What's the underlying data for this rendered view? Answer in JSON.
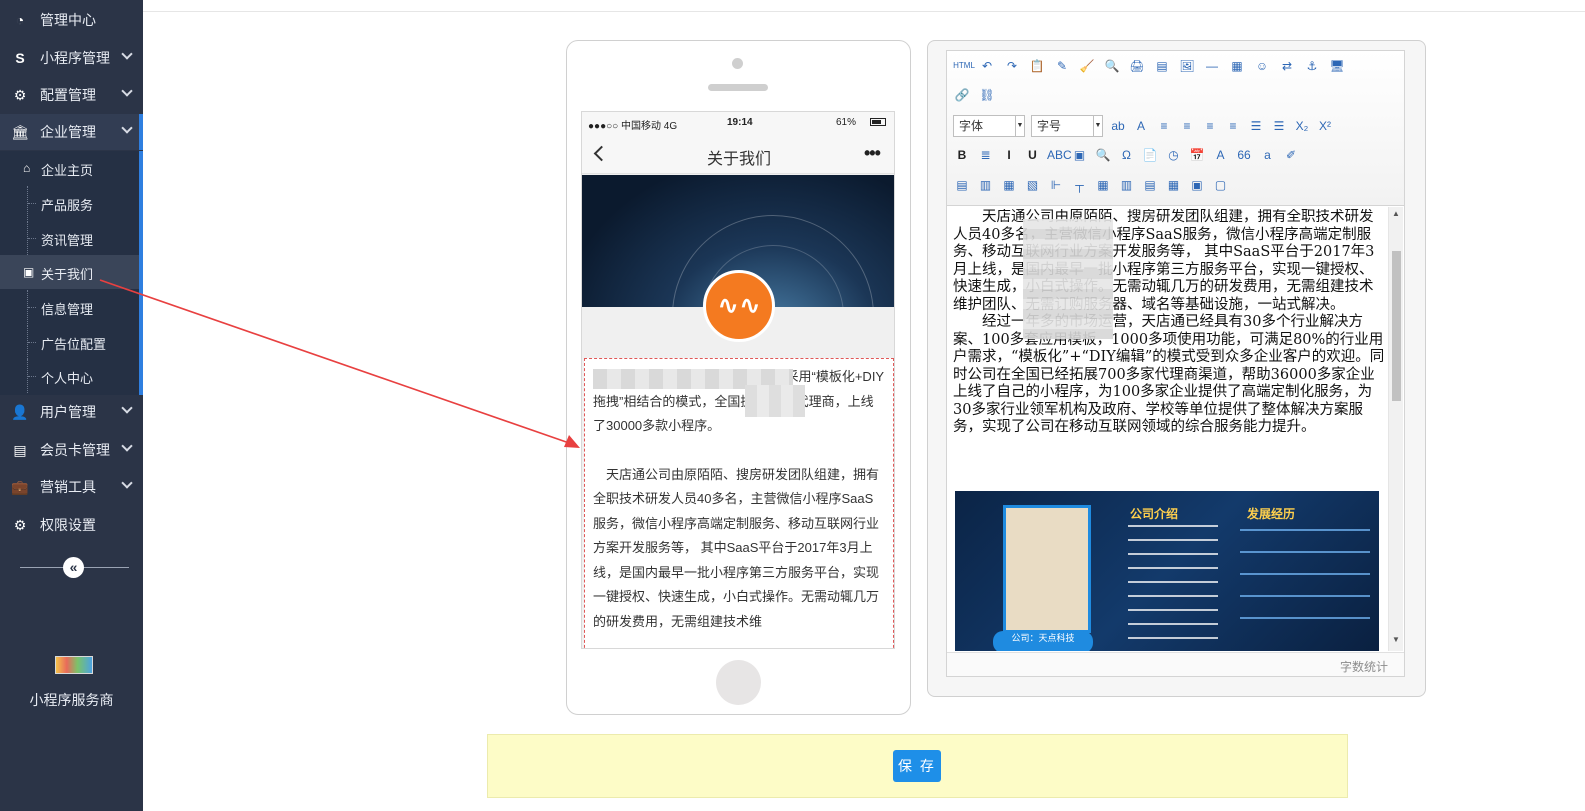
{
  "sidebar": {
    "items": [
      {
        "label": "管理中心",
        "icon": "dashboard-icon"
      },
      {
        "label": "小程序管理",
        "icon": "miniapp-icon"
      },
      {
        "label": "配置管理",
        "icon": "cogs-icon"
      },
      {
        "label": "企业管理",
        "icon": "bank-icon"
      },
      {
        "label": "用户管理",
        "icon": "user-icon"
      },
      {
        "label": "会员卡管理",
        "icon": "card-icon"
      },
      {
        "label": "营销工具",
        "icon": "briefcase-icon"
      },
      {
        "label": "权限设置",
        "icon": "gear-icon"
      }
    ],
    "subitems": [
      {
        "label": "企业主页",
        "icon": "home-icon"
      },
      {
        "label": "产品服务"
      },
      {
        "label": "资讯管理"
      },
      {
        "label": "关于我们",
        "icon": "bus-icon"
      },
      {
        "label": "信息管理"
      },
      {
        "label": "广告位配置"
      },
      {
        "label": "个人中心"
      }
    ],
    "collapse_symbol": "«",
    "footer_label": "小程序服务商"
  },
  "phone": {
    "status": {
      "carrier": "●●●○○ 中国移动  4G",
      "time": "19:14",
      "battery": "61%"
    },
    "title": "关于我们",
    "more": "•••",
    "logo_text": "∿∿",
    "paragraphs": [
      "服务平台，现有1000+功能模块。采用“模板化+DIY拖拽”相结合的模式，全国拥有700+代理商，上线了30000多款小程序。",
      "天店通公司由原陌陌、搜房研发团队组建，拥有全职技术研发人员40多名，主营微信小程序SaaS服务，微信小程序高端定制服务、移动互联网行业方案开发服务等， 其中SaaS平台于2017年3月上线，是国内最早一批小程序第三方服务平台，实现一键授权、快速生成，小白式操作。无需动辄几万的研发费用，无需组建技术维"
    ]
  },
  "editor": {
    "toolbar": {
      "font_family": "字体",
      "font_size": "字号",
      "row1": [
        "HTML",
        "↶",
        "↷",
        "📋",
        "✎",
        "🧹",
        "🔍",
        "🖨",
        "▤",
        "🖼",
        "—",
        "▦",
        "☺",
        "⇄",
        "⚓",
        "🖥"
      ],
      "row2": [
        "🔗",
        "⛓"
      ],
      "row3": [
        "ab",
        "A",
        "≡",
        "≡",
        "≡",
        "≡",
        "☰",
        "☰",
        "X₂",
        "X²"
      ],
      "row4": [
        "B",
        "≣",
        "I",
        "U",
        "ABC",
        "▣",
        "🔍",
        "Ω",
        "📄",
        "◷",
        "📅",
        "A",
        "66",
        "a",
        "✐"
      ],
      "row5": [
        "▤",
        "▥",
        "▦",
        "▧",
        "⊩",
        "┬",
        "▦",
        "▥",
        "▤",
        "▦",
        "▣",
        "▢"
      ]
    },
    "paragraphs": [
      "天店通公司由原陌陌、搜房研发团队组建，拥有全职技术研发人员40多名，主营微信小程序SaaS服务，微信小程序高端定制服务、移动互联网行业方案开发服务等， 其中SaaS平台于2017年3月上线，是国内最早一批小程序第三方服务平台，实现一键授权、快速生成，小白式操作。无需动辄几万的研发费用，无需组建技术维护团队、无需订购服务器、域名等基础设施，一站式解决。",
      "经过一年多的市场运营，天店通已经具有30多个行业解决方案、100多套应用模板，1000多项使用功能，可满足80%的行业用户需求，“模板化”+“DIY编辑”的模式受到众多企业客户的欢迎。同时公司在全国已经拓展700多家代理商渠道，帮助36000多家企业上线了自己的小程序，为100多家企业提供了高端定制化服务，为30多家行业领军机构及政府、学校等单位提供了整体解决方案服务，实现了公司在移动互联网领域的综合服务能力提升。"
    ],
    "image": {
      "heading_left": "公司介绍",
      "heading_right": "发展经历",
      "caption": "公司：天点科技"
    },
    "word_count_label": "字数统计"
  },
  "save_label": "保 存",
  "colors": {
    "sidebar_bg": "#2b3447",
    "accent": "#1e8fe8",
    "annotation_arrow": "#e84040",
    "save_bar": "#fdfcc7"
  }
}
